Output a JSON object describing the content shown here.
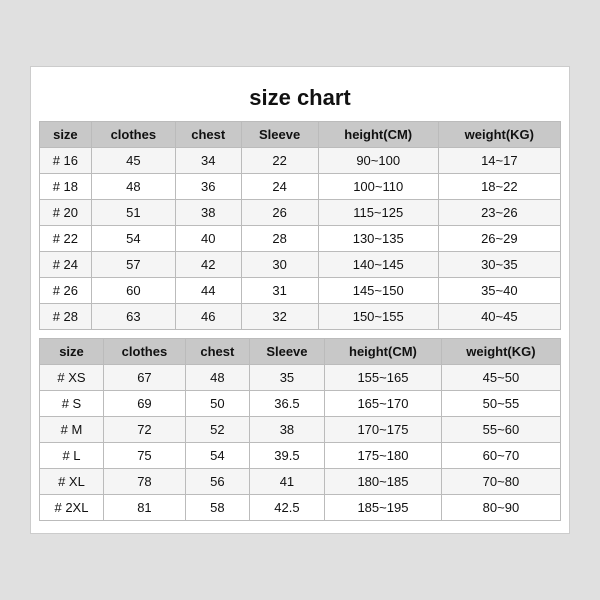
{
  "title": "size chart",
  "table1": {
    "headers": [
      "size",
      "clothes",
      "chest",
      "Sleeve",
      "height(CM)",
      "weight(KG)"
    ],
    "rows": [
      [
        "# 16",
        "45",
        "34",
        "22",
        "90~100",
        "14~17"
      ],
      [
        "# 18",
        "48",
        "36",
        "24",
        "100~110",
        "18~22"
      ],
      [
        "# 20",
        "51",
        "38",
        "26",
        "115~125",
        "23~26"
      ],
      [
        "# 22",
        "54",
        "40",
        "28",
        "130~135",
        "26~29"
      ],
      [
        "# 24",
        "57",
        "42",
        "30",
        "140~145",
        "30~35"
      ],
      [
        "# 26",
        "60",
        "44",
        "31",
        "145~150",
        "35~40"
      ],
      [
        "# 28",
        "63",
        "46",
        "32",
        "150~155",
        "40~45"
      ]
    ]
  },
  "table2": {
    "headers": [
      "size",
      "clothes",
      "chest",
      "Sleeve",
      "height(CM)",
      "weight(KG)"
    ],
    "rows": [
      [
        "# XS",
        "67",
        "48",
        "35",
        "155~165",
        "45~50"
      ],
      [
        "# S",
        "69",
        "50",
        "36.5",
        "165~170",
        "50~55"
      ],
      [
        "# M",
        "72",
        "52",
        "38",
        "170~175",
        "55~60"
      ],
      [
        "# L",
        "75",
        "54",
        "39.5",
        "175~180",
        "60~70"
      ],
      [
        "# XL",
        "78",
        "56",
        "41",
        "180~185",
        "70~80"
      ],
      [
        "# 2XL",
        "81",
        "58",
        "42.5",
        "185~195",
        "80~90"
      ]
    ]
  }
}
